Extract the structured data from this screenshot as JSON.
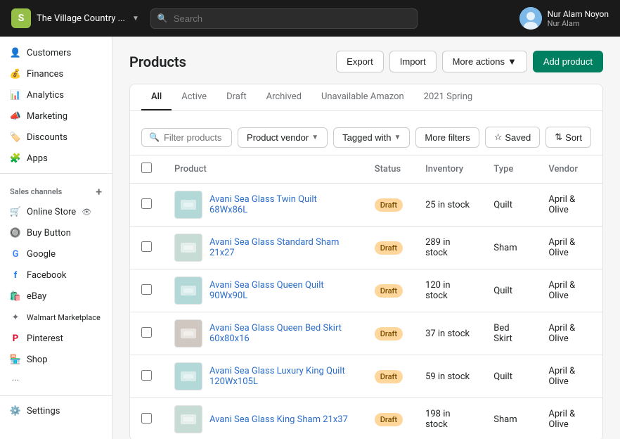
{
  "topbar": {
    "store_name": "The Village Country ...",
    "search_placeholder": "Search",
    "user_name": "Nur Alam Noyon",
    "user_sub": "Nur Alam",
    "shopify_letter": "S"
  },
  "sidebar": {
    "main_items": [
      {
        "id": "customers",
        "label": "Customers",
        "icon": "👤"
      },
      {
        "id": "finances",
        "label": "Finances",
        "icon": "💰"
      },
      {
        "id": "analytics",
        "label": "Analytics",
        "icon": "📊"
      },
      {
        "id": "marketing",
        "label": "Marketing",
        "icon": "📣"
      },
      {
        "id": "discounts",
        "label": "Discounts",
        "icon": "🏷️"
      },
      {
        "id": "apps",
        "label": "Apps",
        "icon": "🧩"
      }
    ],
    "sales_channels_label": "Sales channels",
    "sales_channels": [
      {
        "id": "online-store",
        "label": "Online Store",
        "icon": "🛒",
        "has_eye": true
      },
      {
        "id": "buy-button",
        "label": "Buy Button",
        "icon": "🔘"
      },
      {
        "id": "google",
        "label": "Google",
        "icon": "G"
      },
      {
        "id": "facebook",
        "label": "Facebook",
        "icon": "f"
      },
      {
        "id": "ebay",
        "label": "eBay",
        "icon": "🛍️"
      },
      {
        "id": "walmart",
        "label": "Walmart Marketplace",
        "icon": "✦"
      },
      {
        "id": "pinterest",
        "label": "Pinterest",
        "icon": "P"
      },
      {
        "id": "shop",
        "label": "Shop",
        "icon": "🏪"
      },
      {
        "id": "more",
        "label": "...",
        "icon": ""
      }
    ],
    "settings_label": "Settings"
  },
  "page": {
    "title": "Products",
    "actions": {
      "export": "Export",
      "import": "Import",
      "more_actions": "More actions",
      "add_product": "Add product"
    }
  },
  "tabs": [
    {
      "id": "all",
      "label": "All",
      "active": true
    },
    {
      "id": "active",
      "label": "Active",
      "active": false
    },
    {
      "id": "draft",
      "label": "Draft",
      "active": false
    },
    {
      "id": "archived",
      "label": "Archived",
      "active": false
    },
    {
      "id": "unavailable-amazon",
      "label": "Unavailable Amazon",
      "active": false
    },
    {
      "id": "2021-spring",
      "label": "2021 Spring",
      "active": false
    }
  ],
  "filters": {
    "search_placeholder": "Filter products",
    "product_vendor": "Product vendor",
    "tagged_with": "Tagged with",
    "more_filters": "More filters",
    "saved": "Saved",
    "sort": "Sort"
  },
  "table": {
    "headers": [
      "",
      "Product",
      "Status",
      "Inventory",
      "Type",
      "Vendor"
    ],
    "rows": [
      {
        "id": 1,
        "name": "Avani Sea Glass Twin Quilt 68Wx86L",
        "status": "Draft",
        "inventory": "25 in stock",
        "type": "Quilt",
        "vendor": "April & Olive",
        "thumb_color": "#b2d8d8"
      },
      {
        "id": 2,
        "name": "Avani Sea Glass Standard Sham 21x27",
        "status": "Draft",
        "inventory": "289 in stock",
        "type": "Sham",
        "vendor": "April & Olive",
        "thumb_color": "#c8dcd6"
      },
      {
        "id": 3,
        "name": "Avani Sea Glass Queen Quilt 90Wx90L",
        "status": "Draft",
        "inventory": "120 in stock",
        "type": "Quilt",
        "vendor": "April & Olive",
        "thumb_color": "#b2d8d8"
      },
      {
        "id": 4,
        "name": "Avani Sea Glass Queen Bed Skirt 60x80x16",
        "status": "Draft",
        "inventory": "37 in stock",
        "type": "Bed Skirt",
        "vendor": "April & Olive",
        "thumb_color": "#d0c8c0"
      },
      {
        "id": 5,
        "name": "Avani Sea Glass Luxury King Quilt 120Wx105L",
        "status": "Draft",
        "inventory": "59 in stock",
        "type": "Quilt",
        "vendor": "April & Olive",
        "thumb_color": "#b2d8d8"
      },
      {
        "id": 6,
        "name": "Avani Sea Glass King Sham 21x37",
        "status": "Draft",
        "inventory": "198 in stock",
        "type": "Sham",
        "vendor": "April & Olive",
        "thumb_color": "#c8dcd6"
      }
    ]
  }
}
